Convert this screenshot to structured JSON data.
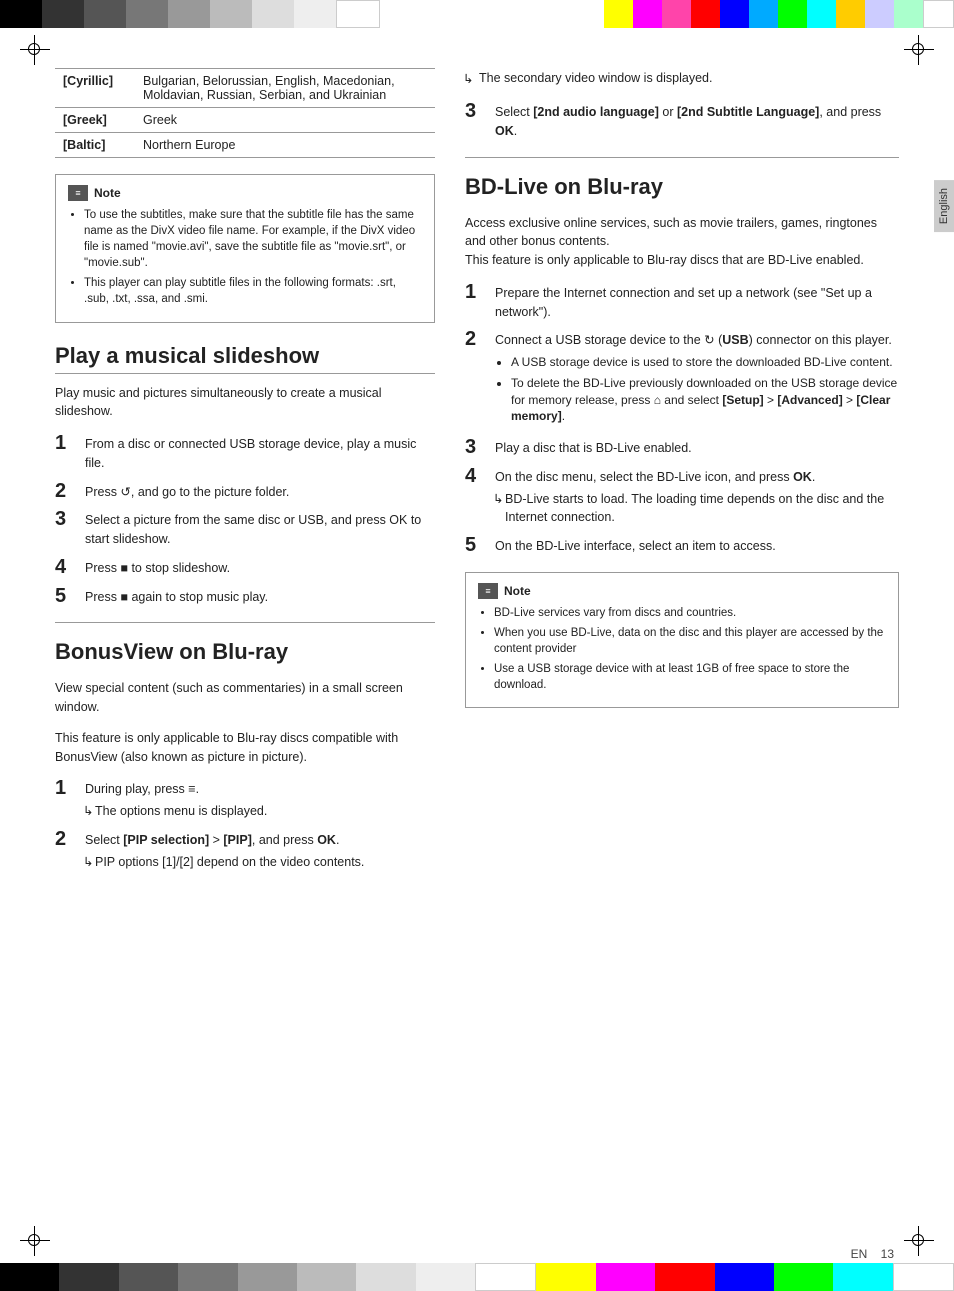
{
  "colorBarsTop": [
    {
      "color": "#000000"
    },
    {
      "color": "#333333"
    },
    {
      "color": "#555555"
    },
    {
      "color": "#777777"
    },
    {
      "color": "#999999"
    },
    {
      "color": "#bbbbbb"
    },
    {
      "color": "#dddddd"
    },
    {
      "color": "#eeeeee"
    },
    {
      "color": "#ffffff"
    },
    {
      "color": "#ffff00"
    },
    {
      "color": "#ff00ff"
    },
    {
      "color": "#ff0000"
    },
    {
      "color": "#0000ff"
    },
    {
      "color": "#00ff00"
    },
    {
      "color": "#00ffff"
    },
    {
      "color": "#ffffff"
    }
  ],
  "colorBarsBottom": [
    {
      "color": "#000000"
    },
    {
      "color": "#333333"
    },
    {
      "color": "#555555"
    },
    {
      "color": "#777777"
    },
    {
      "color": "#999999"
    },
    {
      "color": "#bbbbbb"
    },
    {
      "color": "#dddddd"
    },
    {
      "color": "#eeeeee"
    },
    {
      "color": "#ffffff"
    },
    {
      "color": "#ffff00"
    },
    {
      "color": "#ff00ff"
    },
    {
      "color": "#ff0000"
    },
    {
      "color": "#0000ff"
    },
    {
      "color": "#00ff00"
    },
    {
      "color": "#00ffff"
    },
    {
      "color": "#ffffff"
    }
  ],
  "table": {
    "rows": [
      {
        "key": "[Cyrillic]",
        "value": "Bulgarian, Belorussian, English, Macedonian, Moldavian, Russian, Serbian, and Ukrainian"
      },
      {
        "key": "[Greek]",
        "value": "Greek"
      },
      {
        "key": "[Baltic]",
        "value": "Northern Europe"
      }
    ]
  },
  "noteLeft": {
    "header": "Note",
    "items": [
      "To use the subtitles, make sure that the subtitle file has the same name as the DivX video file name. For example, if the DivX video file is named \"movie.avi\", save the subtitle file as \"movie.srt\", or \"movie.sub\".",
      "This player can play subtitle files in the following formats: .srt, .sub, .txt, .ssa, and .smi."
    ]
  },
  "sectionSlideshow": {
    "title": "Play a musical slideshow",
    "intro": "Play music and pictures simultaneously to create a musical slideshow.",
    "steps": [
      {
        "num": "1",
        "text": "From a disc or connected USB storage device, play a music file."
      },
      {
        "num": "2",
        "text": "Press ↺, and go to the picture folder."
      },
      {
        "num": "3",
        "text": "Select a picture from the same disc or USB, and press OK to start slideshow."
      },
      {
        "num": "4",
        "text": "Press ■ to stop slideshow."
      },
      {
        "num": "5",
        "text": "Press ■ again to stop music play."
      }
    ]
  },
  "sectionBonusView": {
    "title": "BonusView on Blu-ray",
    "intro1": "View special content (such as commentaries) in a small screen window.",
    "intro2": "This feature is only applicable to Blu-ray discs compatible with BonusView (also known as picture in picture).",
    "steps": [
      {
        "num": "1",
        "text": "During play, press ≡.",
        "result": "The options menu is displayed."
      },
      {
        "num": "2",
        "text": "Select [PIP selection] > [PIP], and press OK.",
        "result": "PIP options [1]/[2] depend on the video contents."
      }
    ]
  },
  "rightSecondaryVideo": {
    "result": "The secondary video window is displayed."
  },
  "rightStep3": {
    "num": "3",
    "text": "Select [2nd audio language] or [2nd Subtitle Language], and press OK."
  },
  "sectionBDLive": {
    "title": "BD-Live on Blu-ray",
    "intro": "Access exclusive online services, such as movie trailers, games, ringtones and other bonus contents.\nThis feature is only applicable to Blu-ray discs that are BD-Live enabled.",
    "steps": [
      {
        "num": "1",
        "text": "Prepare the Internet connection and set up a network (see \"Set up a network\")."
      },
      {
        "num": "2",
        "text": "Connect a USB storage device to the ⭕ (USB) connector on this player.",
        "subbullets": [
          "A USB storage device is used to store the downloaded BD-Live content.",
          "To delete the BD-Live previously downloaded on the USB storage device for memory release, press ⌂ and select [Setup] > [Advanced] > [Clear memory]."
        ]
      },
      {
        "num": "3",
        "text": "Play a disc that is BD-Live enabled."
      },
      {
        "num": "4",
        "text": "On the disc menu, select the BD-Live icon, and press OK.",
        "result": "BD-Live starts to load. The loading time depends on the disc and the Internet connection."
      },
      {
        "num": "5",
        "text": "On the BD-Live interface, select an item to access."
      }
    ]
  },
  "noteRight": {
    "header": "Note",
    "items": [
      "BD-Live services vary from discs and countries.",
      "When you use BD-Live, data on the disc and this player are accessed by the content provider",
      "Use a USB storage device with at least 1GB of free space to store the download."
    ]
  },
  "footer": {
    "lang": "EN",
    "page": "13"
  },
  "englishTab": "English"
}
